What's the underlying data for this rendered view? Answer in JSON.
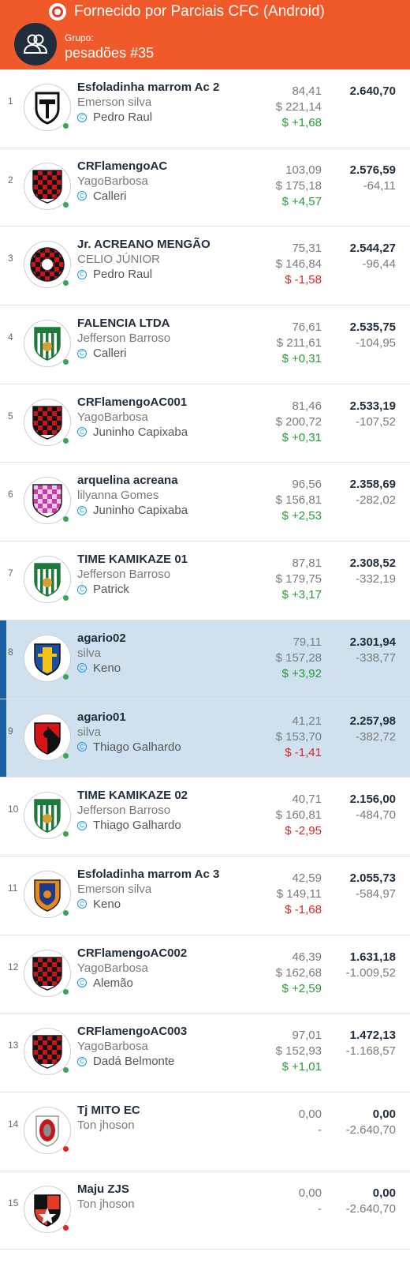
{
  "header": {
    "title": "Fornecido por Parciais CFC (Android)"
  },
  "group": {
    "label": "Grupo:",
    "name": "pesadões #35"
  },
  "colors": {
    "accent": "#f05a2b",
    "positive": "#2a9a35",
    "negative": "#d8262a",
    "highlight": "#cfe0ef"
  },
  "rows": [
    {
      "pos": "1",
      "team": "Esfoladinha marrom Ac 2",
      "owner": "Emerson silva",
      "captain": "Pedro Raul",
      "pts": "84,41",
      "price": "$ 221,14",
      "gain": "$ +1,68",
      "gain_sign": "pos",
      "total": "2.640,70",
      "diff": "",
      "status": "on",
      "highlight": false,
      "crest": "black-white"
    },
    {
      "pos": "2",
      "team": "CRFlamengoAC",
      "owner": "YagoBarbosa",
      "captain": "Calleri",
      "pts": "103,09",
      "price": "$ 175,18",
      "gain": "$ +4,57",
      "gain_sign": "pos",
      "total": "2.576,59",
      "diff": "-64,11",
      "status": "on",
      "highlight": false,
      "crest": "red-checker"
    },
    {
      "pos": "3",
      "team": "Jr. ACREANO MENGÃO",
      "owner": "CELIO JÚNIOR",
      "captain": "Pedro Raul",
      "pts": "75,31",
      "price": "$ 146,84",
      "gain": "$ -1,58",
      "gain_sign": "neg",
      "total": "2.544,27",
      "diff": "-96,44",
      "status": "on",
      "highlight": false,
      "crest": "red-checker-round"
    },
    {
      "pos": "4",
      "team": "FALENCIA LTDA",
      "owner": "Jefferson Barroso",
      "captain": "Calleri",
      "pts": "76,61",
      "price": "$ 211,61",
      "gain": "$ +0,31",
      "gain_sign": "pos",
      "total": "2.535,75",
      "diff": "-104,95",
      "status": "on",
      "highlight": false,
      "crest": "green-stripes"
    },
    {
      "pos": "5",
      "team": "CRFlamengoAC001",
      "owner": "YagoBarbosa",
      "captain": "Juninho Capixaba",
      "pts": "81,46",
      "price": "$ 200,72",
      "gain": "$ +0,31",
      "gain_sign": "pos",
      "total": "2.533,19",
      "diff": "-107,52",
      "status": "on",
      "highlight": false,
      "crest": "red-checker"
    },
    {
      "pos": "6",
      "team": "arquelina acreana",
      "owner": "lilyanna Gomes",
      "captain": "Juninho Capixaba",
      "pts": "96,56",
      "price": "$ 156,81",
      "gain": "$ +2,53",
      "gain_sign": "pos",
      "total": "2.358,69",
      "diff": "-282,02",
      "status": "on",
      "highlight": false,
      "crest": "pink-checker"
    },
    {
      "pos": "7",
      "team": "TIME KAMIKAZE 01",
      "owner": "Jefferson Barroso",
      "captain": "Patrick",
      "pts": "87,81",
      "price": "$ 179,75",
      "gain": "$ +3,17",
      "gain_sign": "pos",
      "total": "2.308,52",
      "diff": "-332,19",
      "status": "on",
      "highlight": false,
      "crest": "green-stripes"
    },
    {
      "pos": "8",
      "team": "agario02",
      "owner": "silva",
      "captain": "Keno",
      "pts": "79,11",
      "price": "$ 157,28",
      "gain": "$ +3,92",
      "gain_sign": "pos",
      "total": "2.301,94",
      "diff": "-338,77",
      "status": "on",
      "highlight": true,
      "crest": "blue-yellow"
    },
    {
      "pos": "9",
      "team": "agario01",
      "owner": "silva",
      "captain": "Thiago Galhardo",
      "pts": "41,21",
      "price": "$ 153,70",
      "gain": "$ -1,41",
      "gain_sign": "neg",
      "total": "2.257,98",
      "diff": "-382,72",
      "status": "on",
      "highlight": true,
      "crest": "red-black"
    },
    {
      "pos": "10",
      "team": "TIME KAMIKAZE 02",
      "owner": "Jefferson Barroso",
      "captain": "Thiago Galhardo",
      "pts": "40,71",
      "price": "$ 160,81",
      "gain": "$ -2,95",
      "gain_sign": "neg",
      "total": "2.156,00",
      "diff": "-484,70",
      "status": "on",
      "highlight": false,
      "crest": "green-stripes"
    },
    {
      "pos": "11",
      "team": "Esfoladinha marrom Ac 3",
      "owner": "Emerson silva",
      "captain": "Keno",
      "pts": "42,59",
      "price": "$ 149,11",
      "gain": "$ -1,68",
      "gain_sign": "neg",
      "total": "2.055,73",
      "diff": "-584,97",
      "status": "on",
      "highlight": false,
      "crest": "orange-blue"
    },
    {
      "pos": "12",
      "team": "CRFlamengoAC002",
      "owner": "YagoBarbosa",
      "captain": "Alemão",
      "pts": "46,39",
      "price": "$ 162,68",
      "gain": "$ +2,59",
      "gain_sign": "pos",
      "total": "1.631,18",
      "diff": "-1.009,52",
      "status": "on",
      "highlight": false,
      "crest": "red-checker"
    },
    {
      "pos": "13",
      "team": "CRFlamengoAC003",
      "owner": "YagoBarbosa",
      "captain": "Dadá Belmonte",
      "pts": "97,01",
      "price": "$ 152,93",
      "gain": "$ +1,01",
      "gain_sign": "pos",
      "total": "1.472,13",
      "diff": "-1.168,57",
      "status": "on",
      "highlight": false,
      "crest": "red-checker"
    },
    {
      "pos": "14",
      "team": "Tj MITO EC",
      "owner": "Ton jhoson",
      "captain": "",
      "pts": "0,00",
      "price": "-",
      "gain": "",
      "gain_sign": "",
      "total": "0,00",
      "diff": "-2.640,70",
      "status": "off",
      "highlight": false,
      "crest": "red-round"
    },
    {
      "pos": "15",
      "team": "Maju ZJS",
      "owner": "Ton jhoson",
      "captain": "",
      "pts": "0,00",
      "price": "-",
      "gain": "",
      "gain_sign": "",
      "total": "0,00",
      "diff": "-2.640,70",
      "status": "off",
      "highlight": false,
      "crest": "red-black-shield"
    }
  ]
}
